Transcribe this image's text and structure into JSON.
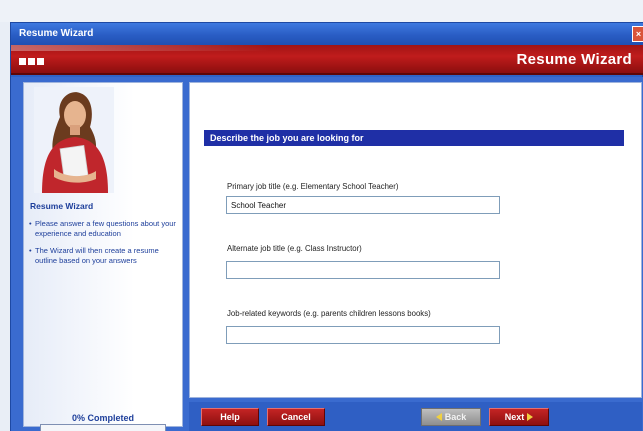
{
  "window": {
    "title": "Resume Wizard",
    "close_symbol": "×"
  },
  "banner": {
    "title": "Resume Wizard"
  },
  "sidebar": {
    "heading": "Resume Wizard",
    "bullets": [
      "Please answer a few questions about your experience and education",
      "The Wizard will then create a resume outline based on your answers"
    ],
    "progress_label": "0% Completed",
    "progress_value": 0
  },
  "main": {
    "section_title": "Describe the job you are looking for",
    "fields": [
      {
        "label": "Primary job title (e.g. Elementary School Teacher)",
        "value": "School Teacher"
      },
      {
        "label": "Alternate job title (e.g. Class Instructor)",
        "value": ""
      },
      {
        "label": "Job-related keywords (e.g. parents children lessons books)",
        "value": ""
      }
    ]
  },
  "buttons": {
    "help": "Help",
    "cancel": "Cancel",
    "back": "Back",
    "next": "Next"
  },
  "colors": {
    "window_blue": "#2f63c6",
    "banner_red": "#a11414",
    "section_blue": "#1f2fa6",
    "link_blue": "#1e3f9b"
  },
  "icons": [
    "close-icon",
    "back-arrow-icon",
    "next-arrow-icon",
    "user-photo"
  ]
}
